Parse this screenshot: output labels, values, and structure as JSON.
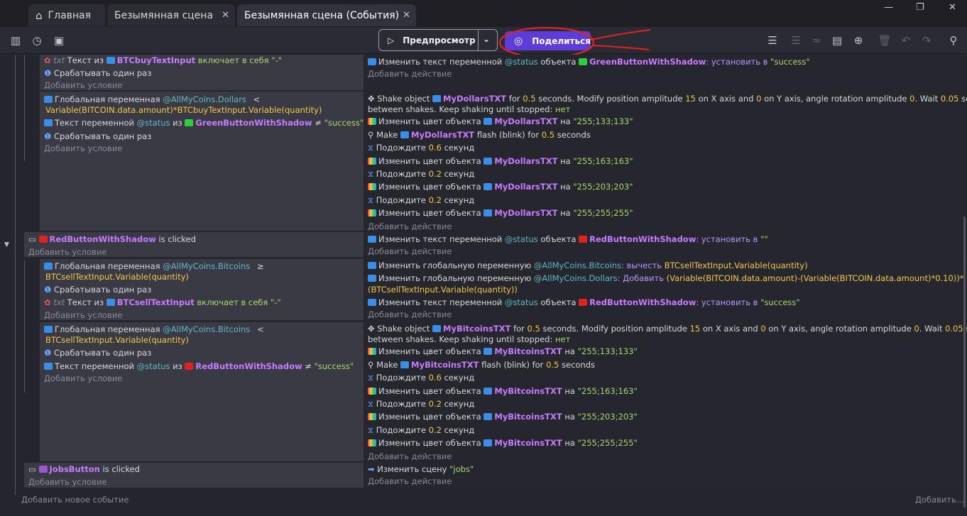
{
  "tabs": {
    "home": "Главная",
    "scene": "Безымянная сцена",
    "events": "Безымянная сцена (События)"
  },
  "toolbar": {
    "preview": "Предпросмотр",
    "share": "Поделиться"
  },
  "blocks": {
    "b1c1": "Текст из",
    "b1c1o": "BTCbuyTextInput",
    "b1c1k": "включает в себя",
    "b1c1s": "\"-\"",
    "once": "Срабатывать один раз",
    "addc": "Добавить условие",
    "adda": "Добавить действие",
    "b1a1": "Изменить текст переменной",
    "b1a1v": "status",
    "b1a1b": "объекта",
    "b1a1o": "GreenButtonWithShadow",
    "b1a1k": ": установить в",
    "b1a1s": "\"success\"",
    "b2c1": "Глобальная переменная",
    "b2c1v": "AllMyCoins.Dollars",
    "b2c1op": "<",
    "b2c1e": "Variable(BITCOIN.data.amount)*BTCbuyTextInput.Variable(quantity)",
    "b2c2": "Текст переменной",
    "b2c2v": "status",
    "b2c2b": "из",
    "b2c2o": "GreenButtonWithShadow",
    "b2c2k": "≠",
    "b2c2s": "\"success\"",
    "shake1a": "Shake object",
    "shake1o": "MyDollarsTXT",
    "shake1b": "for",
    "shake1n1": "0.5",
    "shake1c": "seconds. Modify position amplitude",
    "shake1n2": "15",
    "shake1d": "on X axis and",
    "shake1n3": "0",
    "shake1e": "on Y axis, angle rotation amplitude",
    "shake1n4": "0",
    "shake1f": ". Wait",
    "shake1n5": "0.05",
    "shake1g": "seconds",
    "shake1h": "between shakes. Keep shaking until stopped:",
    "shake1no": "нет",
    "colorchg": "Изменить цвет объекта",
    "na": "на",
    "c1": "\"255;133;133\"",
    "c2": "\"255;163;163\"",
    "c3": "\"255;203;203\"",
    "c4": "\"255;255;255\"",
    "make": "Make",
    "flash": "flash (blink) for",
    "flashn": "0.5",
    "seconds": "seconds",
    "wait": "Подождите",
    "sec": "секунд",
    "w06": "0.6",
    "w02": "0.2",
    "red1": "RedButtonWithShadow",
    "isclicked": "is clicked",
    "r1a": "Изменить текст переменной",
    "r1av": "status",
    "r1ab": "объекта",
    "r1ao": "RedButtonWithShadow",
    "r1ak": ": установить в",
    "r1as": "\"\"",
    "b4c1": "Глобальная переменная",
    "b4c1v": "AllMyCoins.Bitcoins",
    "b4c1op": "≥",
    "b4c1e": "BTCsellTextInput.Variable(quantity)",
    "b4c3": "Текст из",
    "b4c3o": "BTCsellTextInput",
    "b4c3k": "включает в себя",
    "b4c3s": "\"-\"",
    "b4a1": "Изменить глобальную переменную",
    "b4a1v": "AllMyCoins.Bitcoins",
    "b4a1k": ": вычесть",
    "b4a1e": "BTCsellTextInput.Variable(quantity)",
    "b4a2": "Изменить глобальную переменную",
    "b4a2v": "AllMyCoins.Dollars",
    "b4a2k": ": Добавить",
    "b4a2e": "(Variable(BITCOIN.data.amount)-(Variable(BITCOIN.data.amount)*0.10))*",
    "b4a2e2": "(BTCsellTextInput.Variable(quantity))",
    "b4a3": "Изменить текст переменной",
    "b4a3v": "status",
    "b4a3b": "объекта",
    "b4a3o": "RedButtonWithShadow",
    "b4a3k": ": установить в",
    "b4a3s": "\"success\"",
    "b5c1": "Глобальная переменная",
    "b5c1v": "AllMyCoins.Bitcoins",
    "b5c1op": "<",
    "b5c1e": "BTCsellTextInput.Variable(quantity)",
    "b5c3": "Текст переменной",
    "b5c3v": "status",
    "b5c3b": "из",
    "b5c3o": "RedButtonWithShadow",
    "b5c3k": "≠",
    "b5c3s": "\"success\"",
    "shake2o": "MyBitcoinsTXT",
    "jobs": "JobsButton",
    "jobsa": "Изменить сцену",
    "jobss": "\"jobs\"",
    "addevent": "Добавить новое событие",
    "addmore": "Добавить..."
  }
}
